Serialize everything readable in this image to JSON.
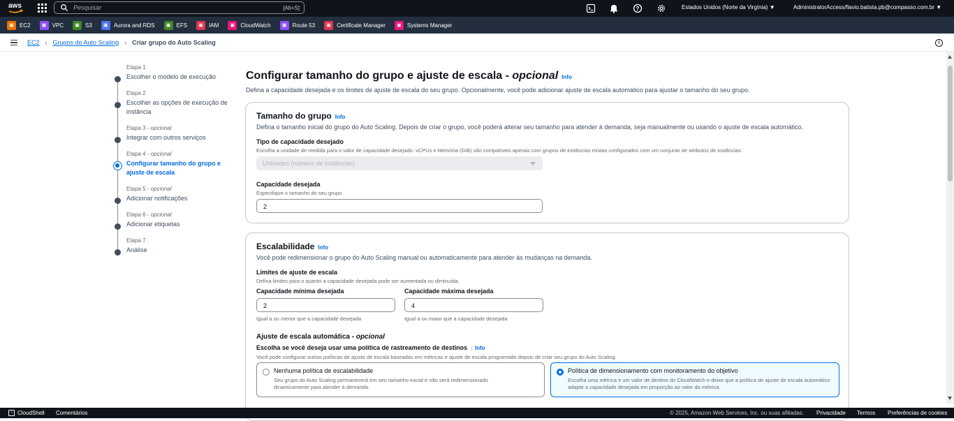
{
  "topbar": {
    "logo_text": "aws",
    "search_placeholder": "Pesquisar",
    "search_shortcut": "[Alt+S]",
    "region": "Estados Unidos (Norte da Virgínia)",
    "account": "AdministratorAccess/flavio.batista.pb@compasso.com.br"
  },
  "favorites": [
    {
      "label": "EC2",
      "color": "#ed7100",
      "icon": "ec2-icon"
    },
    {
      "label": "VPC",
      "color": "#8c4fff",
      "icon": "vpc-icon"
    },
    {
      "label": "S3",
      "color": "#3f8624",
      "icon": "s3-icon"
    },
    {
      "label": "Aurora and RDS",
      "color": "#4d72f3",
      "icon": "rds-icon"
    },
    {
      "label": "EFS",
      "color": "#3f8624",
      "icon": "efs-icon"
    },
    {
      "label": "IAM",
      "color": "#dd344c",
      "icon": "iam-icon"
    },
    {
      "label": "CloudWatch",
      "color": "#e7157b",
      "icon": "cloudwatch-icon"
    },
    {
      "label": "Route 53",
      "color": "#8c4fff",
      "icon": "route53-icon"
    },
    {
      "label": "Certificate Manager",
      "color": "#dd344c",
      "icon": "acm-icon"
    },
    {
      "label": "Systems Manager",
      "color": "#e7157b",
      "icon": "ssm-icon"
    }
  ],
  "breadcrumb": {
    "root": "EC2",
    "parent": "Grupos do Auto Scaling",
    "current": "Criar grupo do Auto Scaling"
  },
  "steps": [
    {
      "label": "Etapa 1",
      "optional": "",
      "title": "Escolher o modelo de execução"
    },
    {
      "label": "Etapa 2",
      "optional": "",
      "title": "Escolher as opções de execução de instância"
    },
    {
      "label": "Etapa 3",
      "optional": "opcional",
      "title": "Integrar com outros serviços"
    },
    {
      "label": "Etapa 4",
      "optional": "opcional",
      "title": "Configurar tamanho do grupo e ajuste de escala"
    },
    {
      "label": "Etapa 5",
      "optional": "opcional",
      "title": "Adicionar notificações"
    },
    {
      "label": "Etapa 6",
      "optional": "opcional",
      "title": "Adicionar etiquetas"
    },
    {
      "label": "Etapa 7",
      "optional": "",
      "title": "Análise"
    }
  ],
  "page": {
    "title": "Configurar tamanho do grupo e ajuste de escala",
    "title_suffix": "opcional",
    "info": "Info",
    "subtitle": "Defina a capacidade desejada e os limites de ajuste de escala do seu grupo. Opcionalmente, você pode adicionar ajuste de escala automático para ajustar o tamanho do seu grupo."
  },
  "group_size": {
    "title": "Tamanho do grupo",
    "info": "Info",
    "desc": "Defina o tamanho inicial do grupo do Auto Scaling. Depois de criar o grupo, você poderá alterar seu tamanho para atender à demanda, seja manualmente ou usando o ajuste de escala automático.",
    "capacity_type_label": "Tipo de capacidade desejado",
    "capacity_type_desc": "Escolha a unidade de medida para o valor de capacidade desejado. vCPUs e Memória (GiB) são compatíveis apenas com grupos de instâncias mistas configurados com um conjunto de atributos de instâncias.",
    "capacity_type_value": "Unidades (número de instâncias)",
    "desired_label": "Capacidade desejada",
    "desired_desc": "Especifique o tamanho do seu grupo.",
    "desired_value": "2"
  },
  "scaling": {
    "title": "Escalabilidade",
    "info": "Info",
    "desc": "Você pode redimensionar o grupo do Auto Scaling manual ou automaticamente para atender às mudanças na demanda.",
    "limits_label": "Limites de ajuste de escala",
    "limits_desc": "Defina limites para o quanto a capacidade desejada pode ser aumentada ou diminuída.",
    "min_label": "Capacidade mínima desejada",
    "min_value": "2",
    "min_hint": "Igual a ou menor que a capacidade desejada",
    "max_label": "Capacidade máxima desejada",
    "max_value": "4",
    "max_hint": "Igual a ou maior que a capacidade desejada",
    "auto_title": "Ajuste de escala automática -",
    "auto_suffix": "opcional",
    "policy_q": "Escolha se você deseja usar uma política de rastreamento de destinos",
    "policy_info": "Info",
    "policy_desc": "Você pode configurar outras políticas de ajuste de escala baseadas em métricas e ajuste de escala programado depois de criar seu grupo do Auto Scaling.",
    "option_none_title": "Nenhuma política de escalabilidade",
    "option_none_desc": "Seu grupo do Auto Scaling permanecerá em seu tamanho inicial e não será redimensionado dinamicamente para atender à demanda.",
    "option_target_title": "Política de dimensionamento com monitoramento do objetivo",
    "option_target_desc": "Escolha uma métrica e um valor de destino do CloudWatch e deixe que a política de ajuste de escala automático adapte a capacidade desejada em proporção ao valor da métrica."
  },
  "footer": {
    "cloudshell": "CloudShell",
    "feedback": "Comentários",
    "copyright": "© 2025, Amazon Web Services, Inc. ou suas afiliadas.",
    "privacy": "Privacidade",
    "terms": "Termos",
    "cookies": "Preferências de cookies"
  }
}
